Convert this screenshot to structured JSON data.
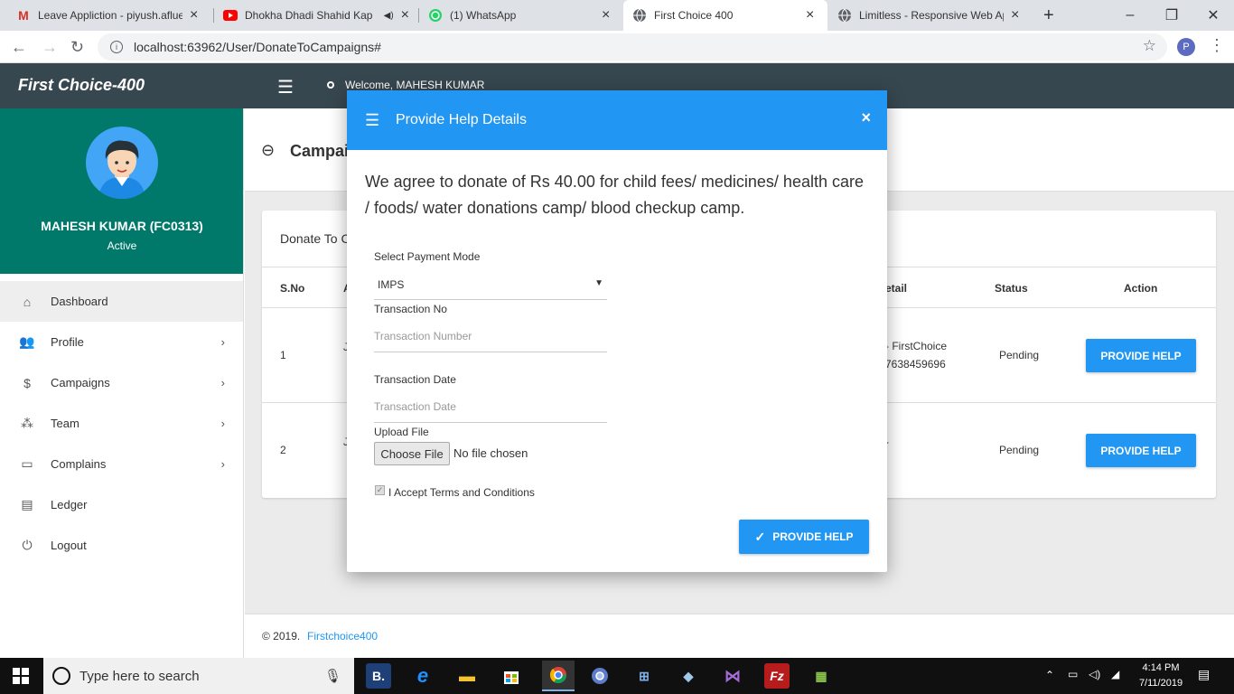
{
  "browser": {
    "tabs": [
      {
        "title": "Leave Appliction - piyush.aflue",
        "icon": "gmail-icon",
        "icon_color": "#d93025"
      },
      {
        "title": "Dhokha Dhadi Shahid Kap",
        "icon": "youtube-icon",
        "icon_color": "#ff0000"
      },
      {
        "title": "(1) WhatsApp",
        "icon": "whatsapp-icon",
        "icon_color": "#25d366"
      },
      {
        "title": "First Choice 400",
        "icon": "globe-icon",
        "icon_color": "#5f6368"
      },
      {
        "title": "Limitless - Responsive Web Ap",
        "icon": "globe-icon",
        "icon_color": "#5f6368"
      }
    ],
    "url": "localhost:63962/User/DonateToCampaigns#",
    "profile_initial": "P"
  },
  "topnav": {
    "brand": "First Choice-400",
    "welcome": "Welcome, MAHESH KUMAR"
  },
  "sidebar": {
    "user_name": "MAHESH KUMAR (FC0313)",
    "user_status": "Active",
    "items": [
      {
        "label": "Dashboard",
        "icon": "home-icon",
        "has_submenu": false
      },
      {
        "label": "Profile",
        "icon": "users-icon",
        "has_submenu": true
      },
      {
        "label": "Campaigns",
        "icon": "donate-icon",
        "has_submenu": true
      },
      {
        "label": "Team",
        "icon": "team-icon",
        "has_submenu": true
      },
      {
        "label": "Complains",
        "icon": "inbox-icon",
        "has_submenu": true
      },
      {
        "label": "Ledger",
        "icon": "card-icon",
        "has_submenu": false
      },
      {
        "label": "Logout",
        "icon": "power-icon",
        "has_submenu": false
      }
    ]
  },
  "page": {
    "title": "Campai",
    "card_title": "Donate To C",
    "columns": [
      "S.No",
      "A",
      "etail",
      "Status",
      "Action"
    ],
    "rows": [
      {
        "sno": "1",
        "col_a": "J",
        "detail_line1": "- FirstChoice",
        "detail_line2": "7638459696",
        "status": "Pending",
        "action": "PROVIDE HELP"
      },
      {
        "sno": "2",
        "col_a": "J",
        "detail_line1": "-",
        "detail_line2": "",
        "status": "Pending",
        "action": "PROVIDE HELP"
      }
    ],
    "footer_text": "© 2019. ",
    "footer_link": "Firstchoice400"
  },
  "modal": {
    "title": "Provide Help Details",
    "close": "×",
    "message": "We agree to donate of Rs 40.00 for child fees/ medicines/ health care / foods/ water donations camp/ blood checkup camp.",
    "payment_mode_label": "Select Payment Mode",
    "payment_mode_value": "IMPS",
    "transaction_no_label": "Transaction No",
    "transaction_no_placeholder": "Transaction Number",
    "transaction_date_label": "Transaction Date",
    "transaction_date_placeholder": "Transaction Date",
    "upload_label": "Upload File",
    "choose_file": "Choose File",
    "no_file": "No file chosen",
    "terms": "I Accept Terms and Conditions",
    "terms_checked": true,
    "submit": "PROVIDE HELP"
  },
  "taskbar": {
    "search_placeholder": "Type here to search",
    "time": "4:14 PM",
    "date": "7/11/2019",
    "accent": "#2196f3"
  }
}
